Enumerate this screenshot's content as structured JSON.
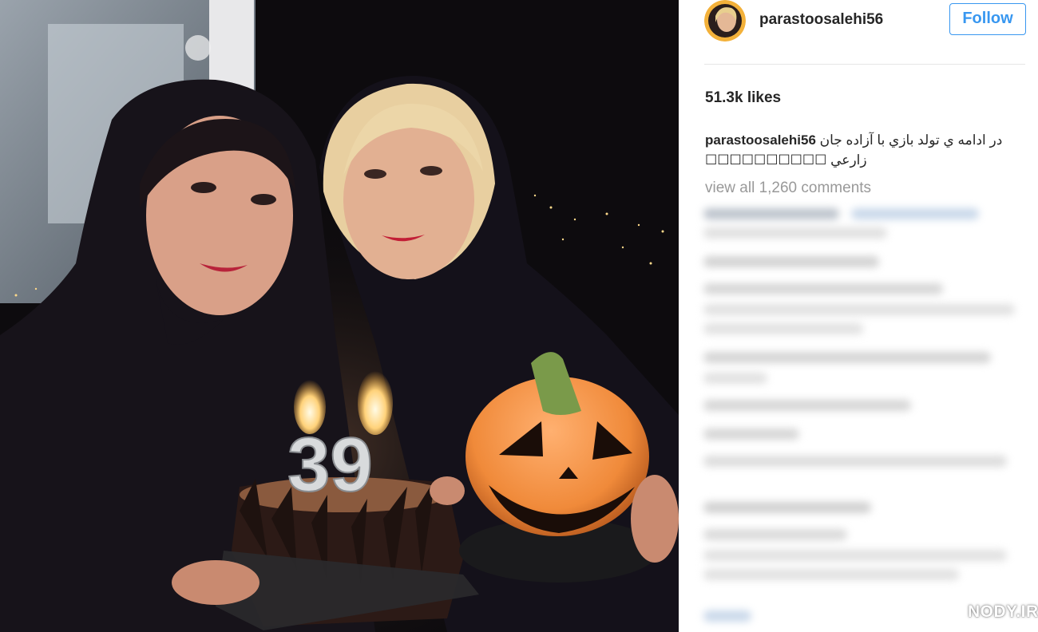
{
  "post": {
    "username": "parastoosalehi56",
    "follow_label": "Follow",
    "likes": "51.3k likes",
    "caption_username": "parastoosalehi56",
    "caption_text": "در ادامه ي تولد بازي با آزاده جان زارعي ☐☐☐☐☐☐☐☐☐☐",
    "view_all": "view all 1,260 comments"
  },
  "photo": {
    "candle_number": "39"
  },
  "watermark": {
    "text": "NODY.IR"
  },
  "colors": {
    "follow_blue": "#3897f0",
    "text_dark": "#262626",
    "text_muted": "#999999"
  }
}
